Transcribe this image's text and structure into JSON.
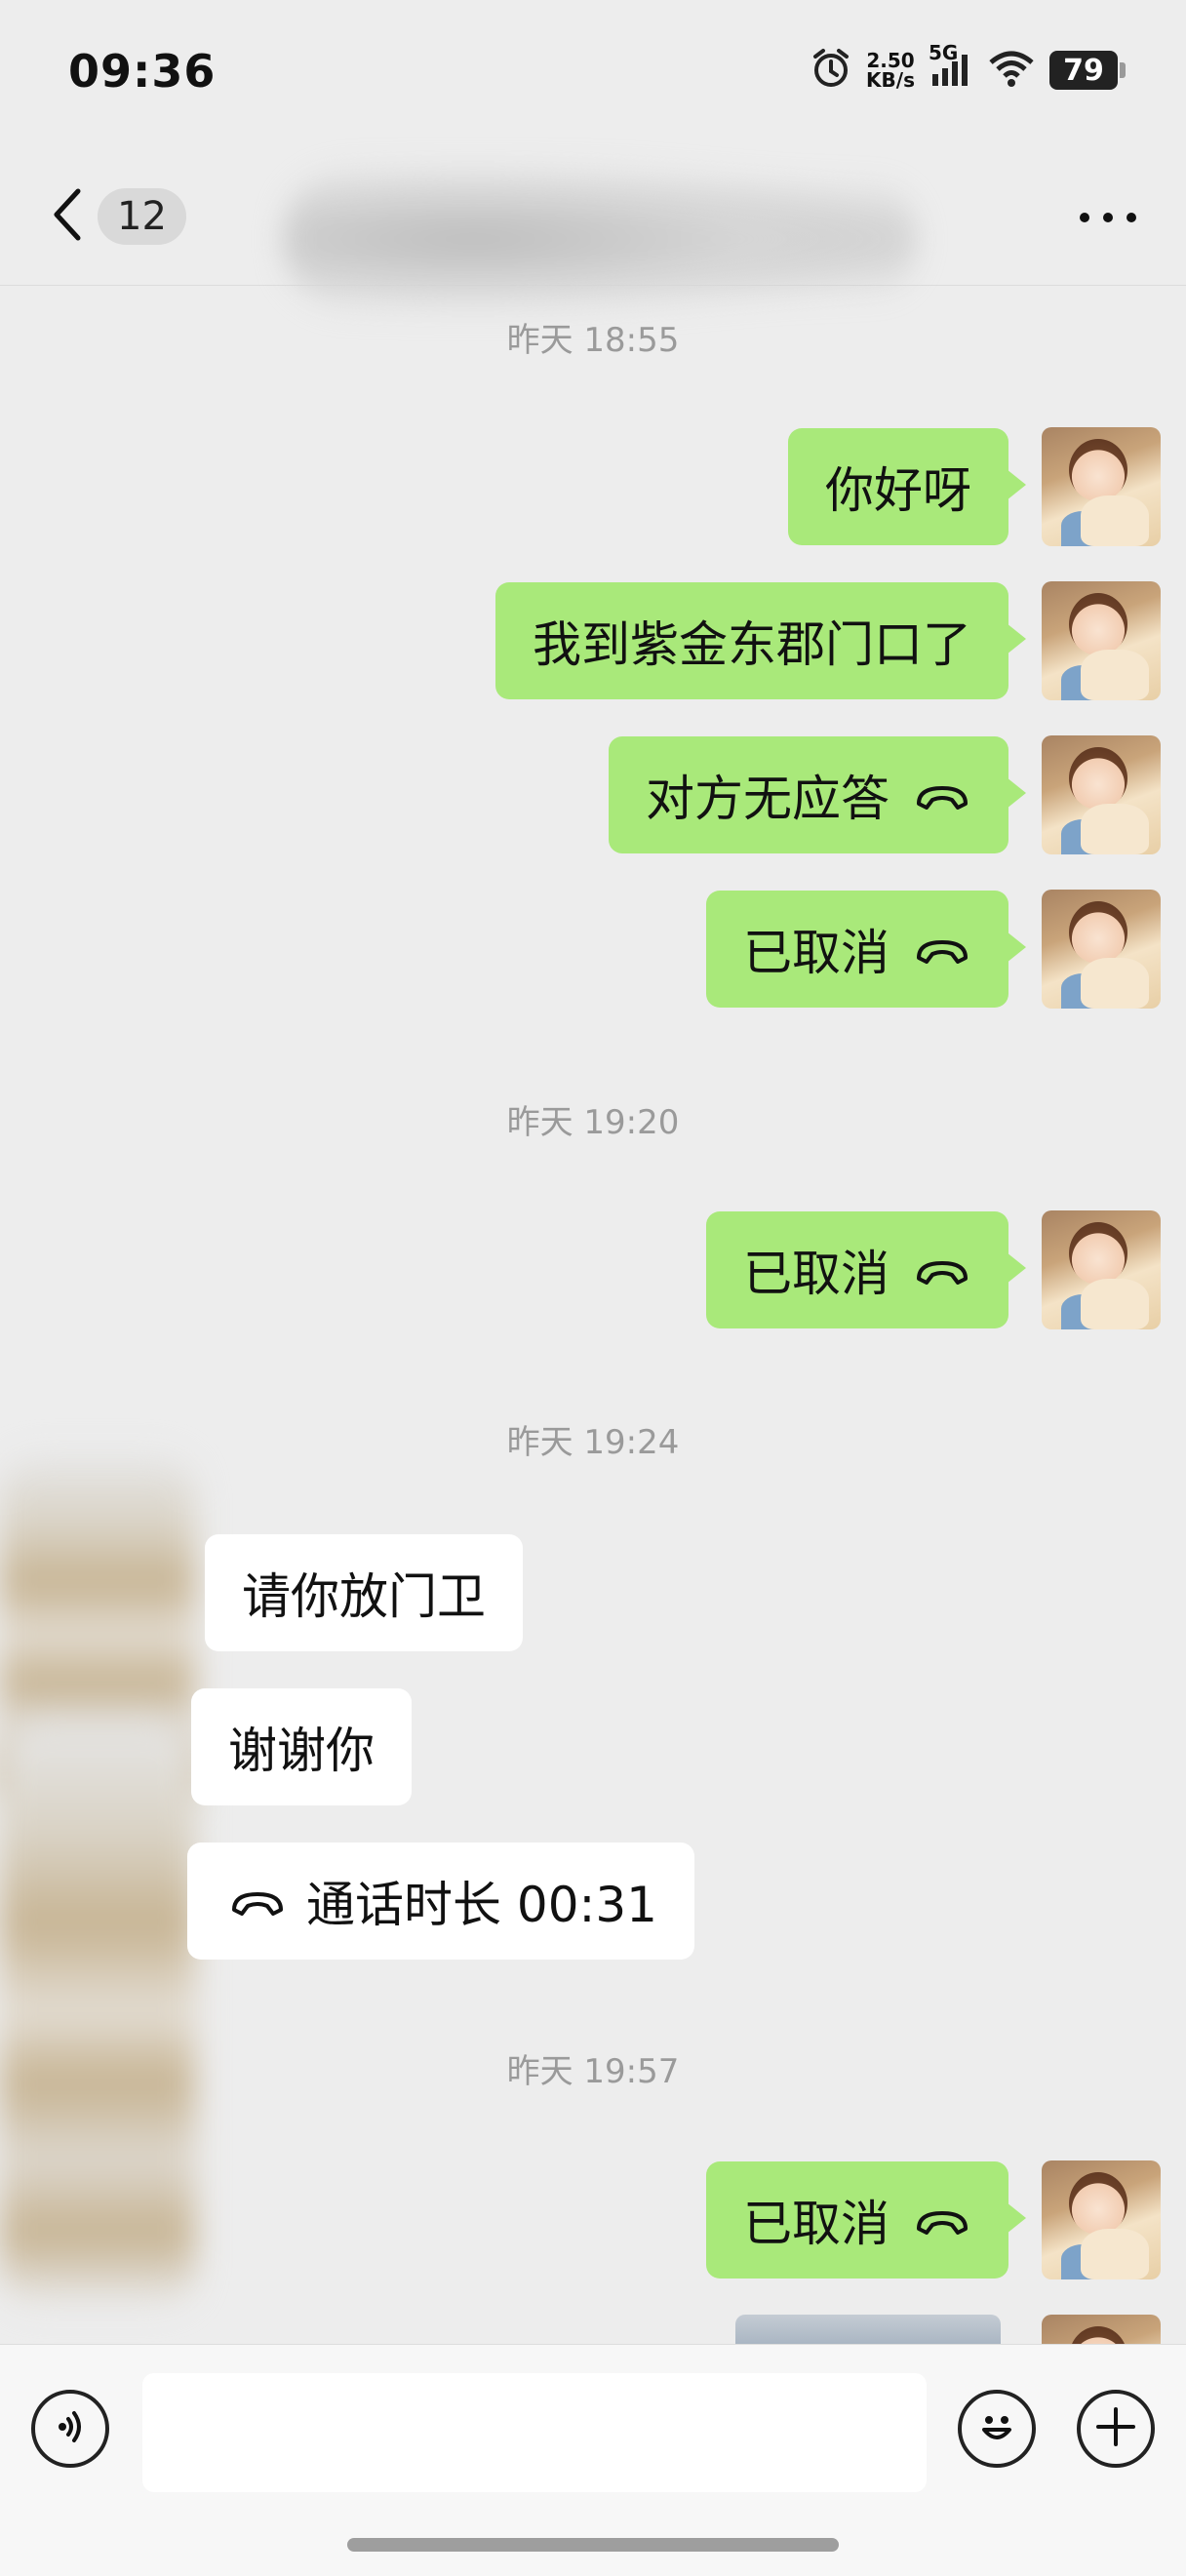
{
  "status_bar": {
    "time": "09:36",
    "net_speed_value": "2.50",
    "net_speed_unit": "KB/s",
    "network_type": "5G",
    "battery_level": "79"
  },
  "header": {
    "unread_count": "12",
    "title": ""
  },
  "messages": [
    {
      "type": "timestamp",
      "text": "昨天 18:55"
    },
    {
      "type": "outgoing",
      "text": "你好呀"
    },
    {
      "type": "outgoing",
      "text": "我到紫金东郡门口了"
    },
    {
      "type": "outgoing",
      "text": "对方无应答",
      "icon": "phone-hangup-icon"
    },
    {
      "type": "outgoing",
      "text": "已取消",
      "icon": "phone-hangup-icon"
    },
    {
      "type": "timestamp",
      "text": "昨天 19:20"
    },
    {
      "type": "outgoing",
      "text": "已取消",
      "icon": "phone-hangup-icon"
    },
    {
      "type": "timestamp",
      "text": "昨天 19:24"
    },
    {
      "type": "incoming",
      "text": "请你放门卫"
    },
    {
      "type": "incoming",
      "text": "谢谢你"
    },
    {
      "type": "incoming",
      "text": "通话时长 00:31",
      "icon": "phone-hangup-icon"
    },
    {
      "type": "timestamp",
      "text": "昨天 19:57"
    },
    {
      "type": "outgoing",
      "text": "已取消",
      "icon": "phone-hangup-icon"
    },
    {
      "type": "outgoing",
      "kind": "image",
      "partially_visible": true
    }
  ],
  "input_bar": {
    "voice_icon": "voice-icon",
    "emoji_icon": "emoji-icon",
    "plus_icon": "plus-icon",
    "value": ""
  },
  "colors": {
    "background": "#ededed",
    "outgoing_bubble": "#a9e97a",
    "incoming_bubble": "#ffffff",
    "timestamp_text": "#9a9a9a"
  }
}
